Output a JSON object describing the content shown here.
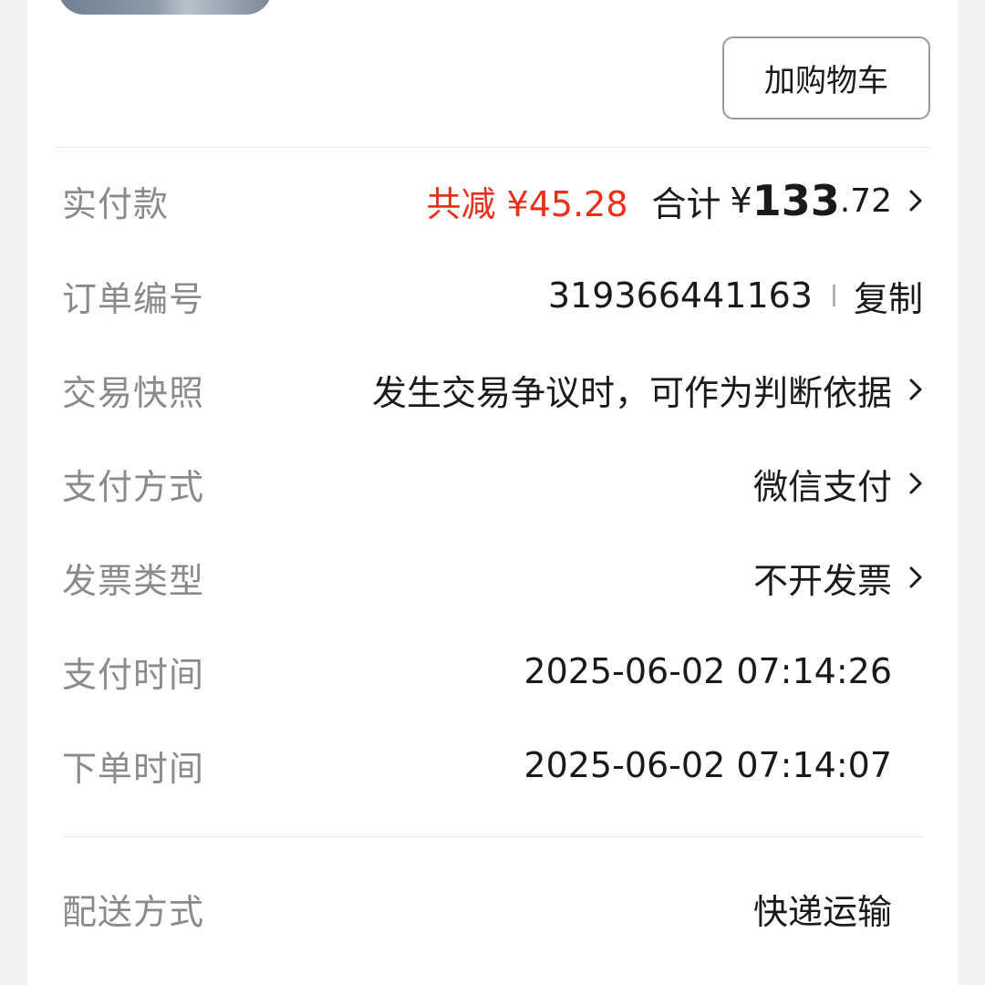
{
  "header": {
    "add_to_cart": "加购物车"
  },
  "payment": {
    "label": "实付款",
    "discount_text": "共减 ¥45.28",
    "total_label": "合计",
    "currency": "¥",
    "total_integer": "133",
    "total_decimal": ".72"
  },
  "order_number": {
    "label": "订单编号",
    "value": "319366441163",
    "copy_label": "复制"
  },
  "snapshot": {
    "label": "交易快照",
    "value": "发生交易争议时，可作为判断依据"
  },
  "pay_method": {
    "label": "支付方式",
    "value": "微信支付"
  },
  "invoice": {
    "label": "发票类型",
    "value": "不开发票"
  },
  "pay_time": {
    "label": "支付时间",
    "value": "2025-06-02 07:14:26"
  },
  "order_time": {
    "label": "下单时间",
    "value": "2025-06-02 07:14:07"
  },
  "delivery": {
    "label": "配送方式",
    "value": "快递运输"
  },
  "icons": {
    "chevron": "chevron-right-icon",
    "thumbnail": "product-thumbnail"
  },
  "colors": {
    "accent_red": "#e8301c",
    "label_gray": "#8a8a8a",
    "text_dark": "#1a1a1a"
  }
}
